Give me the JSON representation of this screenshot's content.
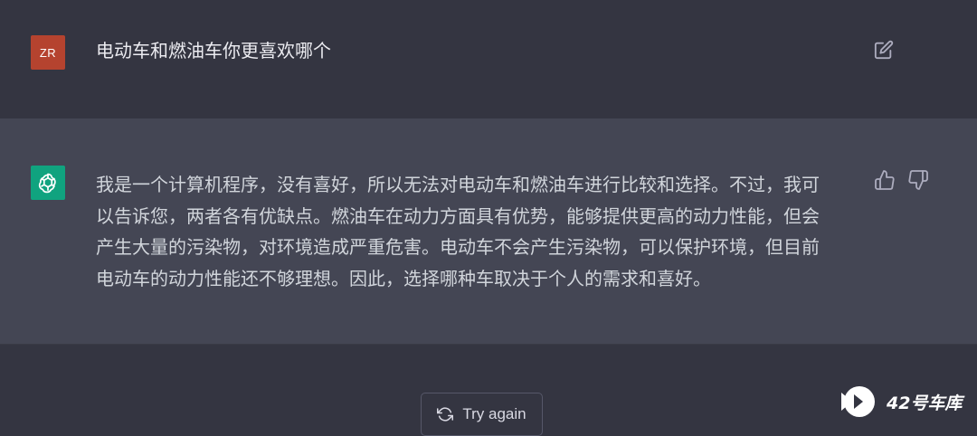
{
  "user_message": {
    "avatar_initials": "ZR",
    "text": "电动车和燃油车你更喜欢哪个"
  },
  "assistant_message": {
    "lines": [
      "我是一个计算机程序，没有喜好，所以无法对电动车和燃油车进行比较和选择。不过，我可",
      "以告诉您，两者各有优缺点。燃油车在动力方面具有优势，能够提供更高的动力性能，但会",
      "产生大量的污染物，对环境造成严重危害。电动车不会产生污染物，可以保护环境，但目前",
      "电动车的动力性能还不够理想。因此，选择哪种车取决于个人的需求和喜好。"
    ]
  },
  "actions": {
    "try_again_label": "Try again"
  },
  "watermark": {
    "text": "42号车库"
  },
  "colors": {
    "background": "#343541",
    "assistant_row": "#444654",
    "user_avatar": "#b5432f",
    "assistant_avatar": "#10a37f"
  },
  "icons": [
    "edit-icon",
    "openai-logo-icon",
    "thumbs-up-icon",
    "thumbs-down-icon",
    "refresh-icon"
  ]
}
